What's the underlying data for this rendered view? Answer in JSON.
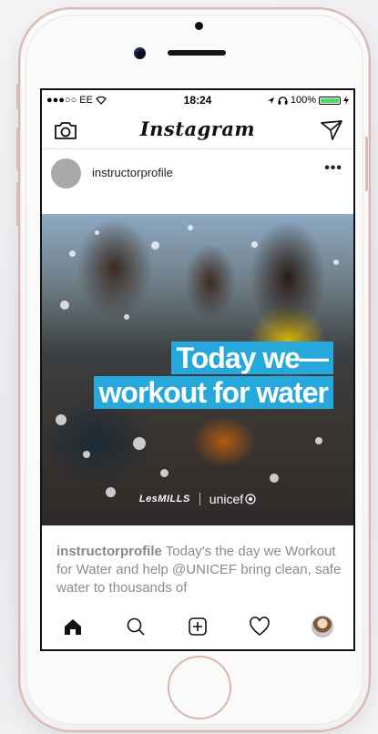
{
  "status_bar": {
    "carrier": "●●●○○ EE",
    "time": "18:24",
    "battery_text": "100%",
    "battery_color": "#4cd964"
  },
  "nav": {
    "title": "Instagram",
    "left_icon": "camera-icon",
    "right_icon": "paper-plane-icon"
  },
  "post": {
    "username": "instructorprofile",
    "more_label": "•••",
    "headline_line1": "Today we—",
    "headline_line2": "workout for water",
    "headline_color": "#26a8dc",
    "brand_left": "LesMILLS",
    "brand_right": "unicef",
    "caption_user": "instructorprofile",
    "caption_text": " Today's the day we Workout for Water and help @UNICEF bring clean, safe water to thousands of"
  },
  "tabbar": {
    "items": [
      "home-icon",
      "search-icon",
      "add-post-icon",
      "heart-icon",
      "profile-avatar"
    ]
  }
}
